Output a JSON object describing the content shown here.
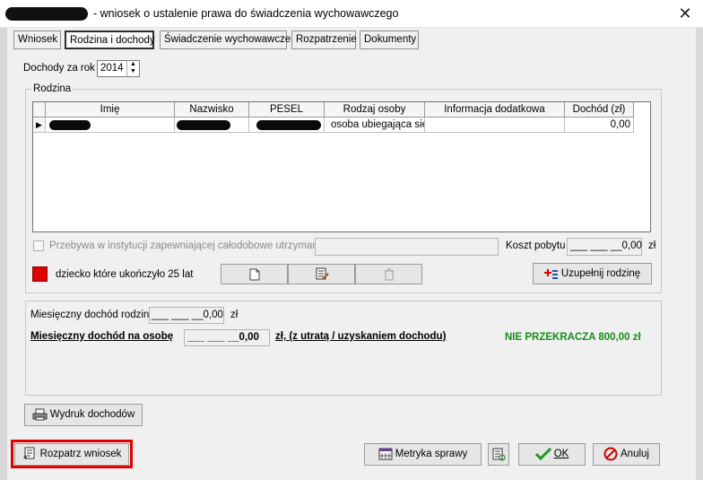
{
  "window": {
    "title": "- wniosek o ustalenie prawa do świadczenia wychowawczego",
    "close_glyph": "✕"
  },
  "tabs": [
    {
      "label": "Wniosek"
    },
    {
      "label": "Rodzina i dochody",
      "active": true
    },
    {
      "label": "Świadczenie wychowawcze"
    },
    {
      "label": "Rozpatrzenie"
    },
    {
      "label": "Dokumenty"
    }
  ],
  "income_year": {
    "label": "Dochody za rok",
    "value": "2014"
  },
  "family": {
    "group_label": "Rodzina",
    "columns": [
      "Imię",
      "Nazwisko",
      "PESEL",
      "Rodzaj osoby",
      "Informacja dodatkowa",
      "Dochód (zł)"
    ],
    "rows": [
      {
        "imie": "",
        "nazwisko": "",
        "pesel": "",
        "rodzaj": "osoba ubiegająca się",
        "info": "",
        "dochod": "0,00"
      }
    ]
  },
  "institution": {
    "label": "Przebywa w instytucji zapewniającej całodobowe utrzymanie :",
    "value": "",
    "cost_label": "Koszt pobytu",
    "cost_value": "___ ___ __0,00",
    "currency": "zł"
  },
  "child_legend": {
    "label": "dziecko które ukończyło 25 lat",
    "color": "#e00000"
  },
  "buttons": {
    "fill_family": "Uzupełnij rodzinę",
    "income_print": "Wydruk dochodów",
    "review": "Rozpatrz wniosek",
    "metric": "Metryka sprawy",
    "ok": "OK",
    "cancel": "Anuluj"
  },
  "income": {
    "family_label": "Miesięczny dochód rodziny",
    "family_value": "___ ___ __0,00",
    "currency": "zł",
    "per_person_label": "Miesięczny dochód na osobę",
    "per_person_value": "___ ___ __0,00",
    "per_person_suffix": "zł, (z utratą / uzyskaniem dochodu)",
    "status": "NIE PRZEKRACZA 800,00 zł"
  },
  "colors": {
    "status_green": "#178f17",
    "highlight_red": "#e00000"
  }
}
